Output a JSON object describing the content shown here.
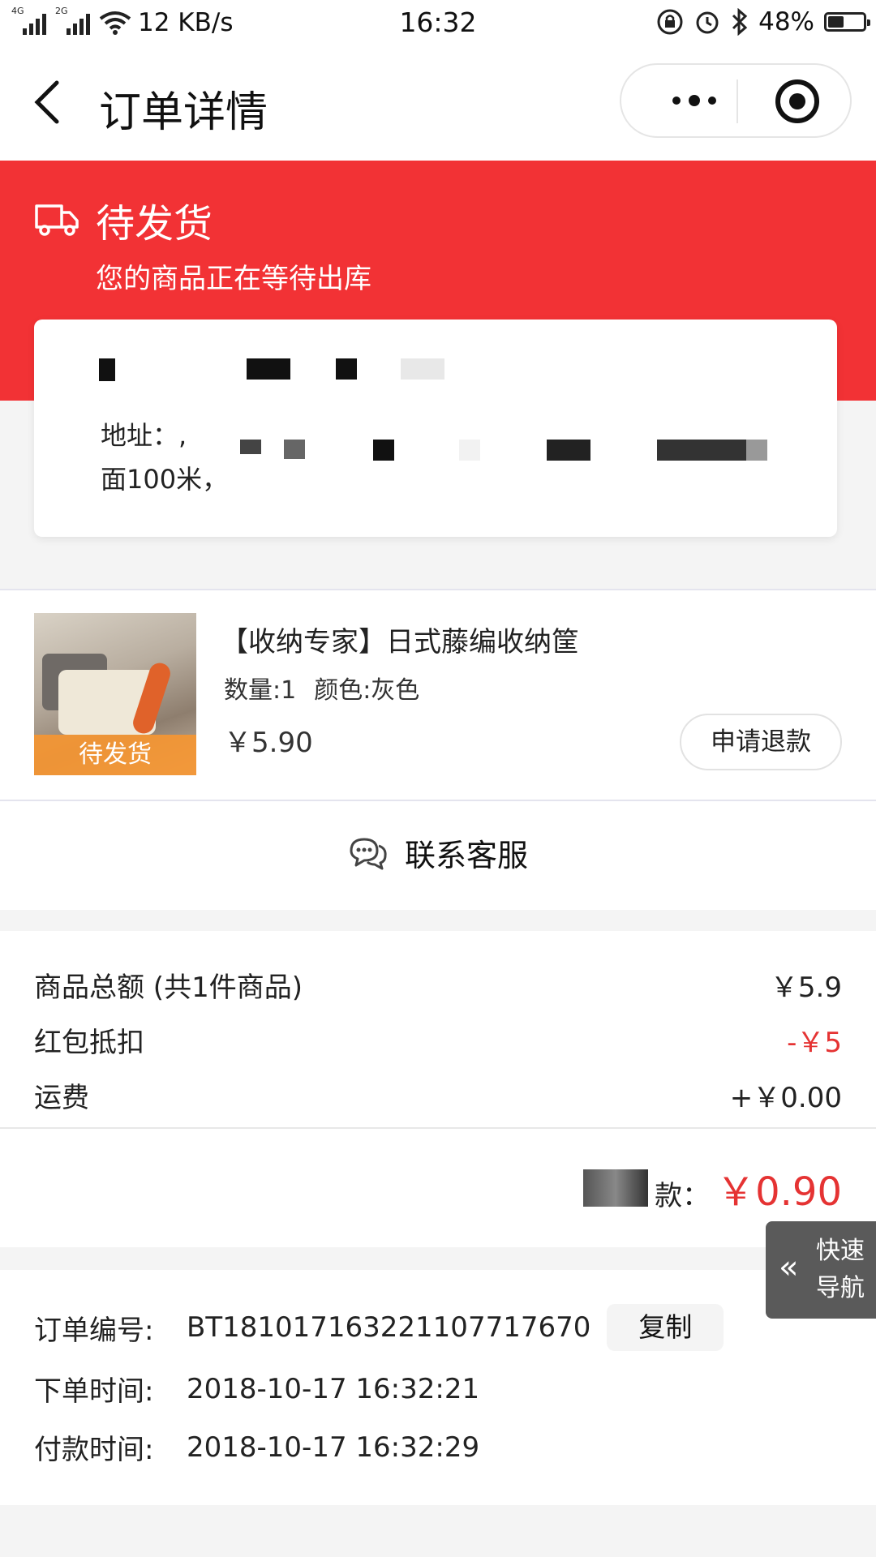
{
  "status_bar": {
    "net1": "4G",
    "net2": "2G",
    "speed": "12 KB/s",
    "time": "16:32",
    "battery": "48%",
    "battery_level": 0.48
  },
  "nav": {
    "title": "订单详情"
  },
  "banner": {
    "title": "待发货",
    "subtitle": "您的商品正在等待出库",
    "color": "#f23235"
  },
  "address": {
    "line1": "地址：,",
    "line2": "面100米，"
  },
  "product": {
    "title": "【收纳专家】日式藤编收纳筐",
    "quantity": "数量:1",
    "color": "颜色:灰色",
    "price": "￥5.90",
    "badge": "待发货",
    "refund_label": "申请退款"
  },
  "contact": {
    "label": "联系客服"
  },
  "summary": {
    "rows": [
      {
        "label": "商品总额 (共1件商品)",
        "value": "￥5.9"
      },
      {
        "label": "红包抵扣",
        "value": "-￥5"
      },
      {
        "label": "运费",
        "value": "+￥0.00"
      }
    ],
    "total_label": "款：",
    "total_value": "￥0.90",
    "accent": "#e53333"
  },
  "order": {
    "number_label": "订单编号:",
    "number": "BT181017163221107717670",
    "copy_label": "复制",
    "created_label": "下单时间:",
    "created": "2018-10-17 16:32:21",
    "paid_label": "付款时间:",
    "paid": "2018-10-17 16:32:29"
  },
  "quick_nav": {
    "line1": "快速",
    "line2": "导航"
  }
}
